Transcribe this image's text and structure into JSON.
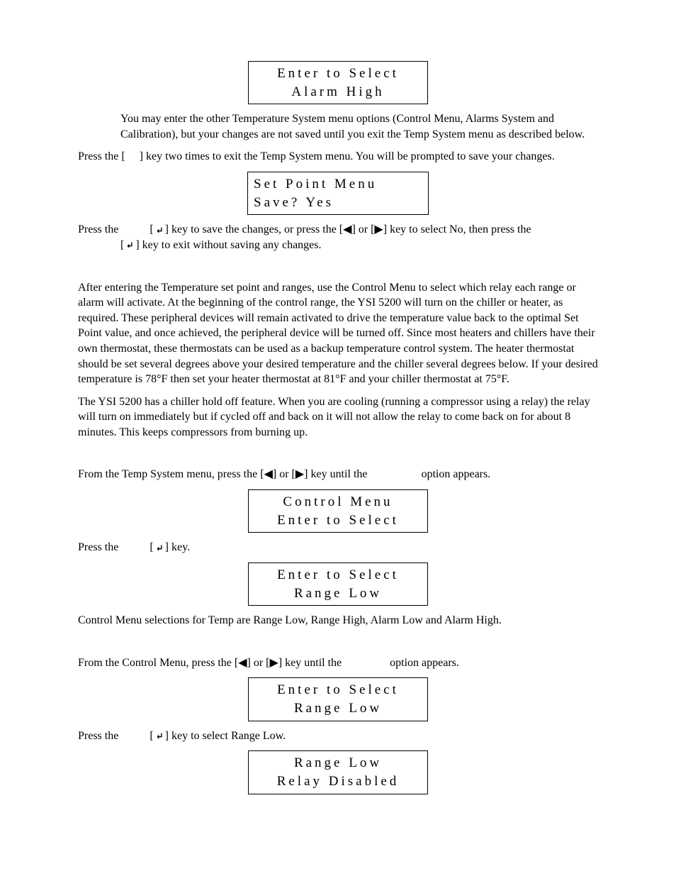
{
  "icons": {
    "left_arrow": "◀",
    "right_arrow": "▶"
  },
  "lcd": {
    "alarm_high": {
      "line1": "Enter to Select",
      "line2": "Alarm High"
    },
    "save": {
      "line1": "Set Point Menu",
      "line2": "Save? Yes"
    },
    "control_menu": {
      "line1": "Control Menu",
      "line2": "Enter to Select"
    },
    "range_low1": {
      "line1": "Enter to Select",
      "line2": "Range Low"
    },
    "range_low2": {
      "line1": "Enter to Select",
      "line2": "Range Low"
    },
    "relay_disabled": {
      "line1": "Range Low",
      "line2": "Relay Disabled"
    }
  },
  "text": {
    "p1": "You may enter the other Temperature System menu options (Control Menu, Alarms System and Calibration), but your changes are not saved until you exit the Temp System menu as described below.",
    "p2a": "Press the [",
    "p2b": "] key two times to exit the Temp System menu. You will be prompted to save your changes.",
    "p3a": "Press the",
    "p3b": "] key to save the changes, or press the [",
    "p3c": "] or [",
    "p3d": "] key to select No, then press the",
    "p3e": "] key to exit without saving any changes.",
    "p4": "After entering the Temperature set point and ranges, use the Control Menu to select which relay each range or alarm will activate. At the beginning of the control range, the YSI 5200 will turn on the chiller or heater, as required. These peripheral devices will remain activated to drive the temperature value back to the optimal Set Point value, and once achieved, the peripheral device will be turned off. Since most heaters and chillers have their own thermostat, these thermostats can be used as a backup temperature control system. The heater thermostat should be set several degrees above your desired temperature and the chiller several degrees below. If your desired temperature is 78°F then set your heater thermostat at 81°F and your chiller thermostat at 75°F.",
    "p5": "The YSI 5200 has a chiller hold off feature. When you are cooling (running a compressor using a relay) the relay will turn on immediately but if cycled off and back on it will not allow the relay to come back on for about 8 minutes. This keeps compressors from burning up.",
    "p6a": "From the Temp System menu, press the [",
    "p6b": "] or [",
    "p6c": "] key until the",
    "p6d": "option appears.",
    "p7a": "Press the",
    "p7b": "] key.",
    "p8": "Control Menu selections for Temp are Range Low, Range High, Alarm Low and Alarm High.",
    "p9a": "From the Control Menu, press the [",
    "p9b": "] or [",
    "p9c": "] key until the",
    "p9d": "option appears.",
    "p10a": "Press the",
    "p10b": "] key to select Range Low."
  }
}
